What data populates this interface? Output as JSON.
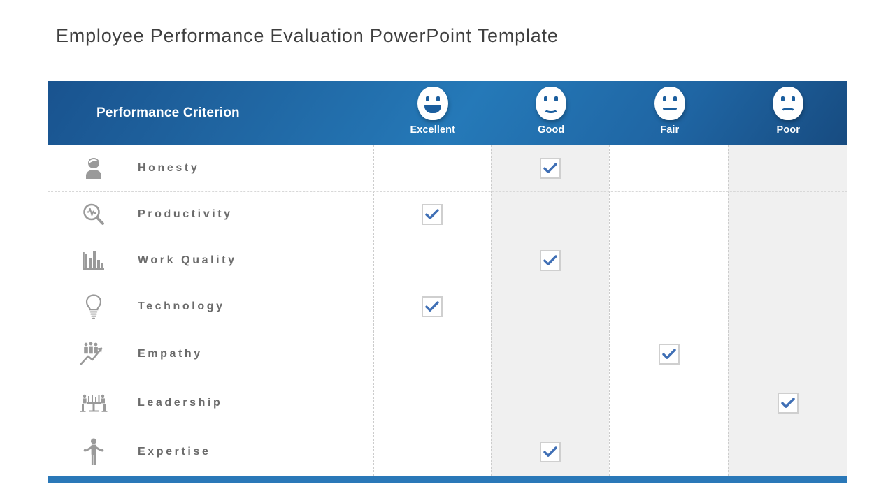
{
  "title": "Employee Performance Evaluation PowerPoint Template",
  "theme": {
    "header_blue_dark": "#174b80",
    "header_blue_light": "#2579b8",
    "bottom_bar_blue": "#2a78b8",
    "check_blue": "#3f6fb5",
    "stripe_gray": "#f0f0f0",
    "icon_gray": "#9a9a9a",
    "label_gray": "#6b6b6b",
    "title_gray": "#3f3f3f"
  },
  "table": {
    "criterion_header": "Performance Criterion",
    "ratings": [
      {
        "label": "Excellent",
        "face": "smiley-open-mouth-icon"
      },
      {
        "label": "Good",
        "face": "smiley-smile-icon"
      },
      {
        "label": "Fair",
        "face": "smiley-neutral-icon"
      },
      {
        "label": "Poor",
        "face": "smiley-frown-icon"
      }
    ],
    "shaded_columns": [
      "Good",
      "Poor"
    ],
    "rows": [
      {
        "label": "Honesty",
        "icon": "person-icon",
        "rating": "Good"
      },
      {
        "label": "Productivity",
        "icon": "magnifier-pulse-icon",
        "rating": "Excellent"
      },
      {
        "label": "Work Quality",
        "icon": "bar-chart-icon",
        "rating": "Good"
      },
      {
        "label": "Technology",
        "icon": "lightbulb-icon",
        "rating": "Excellent"
      },
      {
        "label": "Empathy",
        "icon": "team-growth-icon",
        "rating": "Fair"
      },
      {
        "label": "Leadership",
        "icon": "meeting-table-icon",
        "rating": "Poor"
      },
      {
        "label": "Expertise",
        "icon": "person-arms-out-icon",
        "rating": "Good"
      }
    ]
  },
  "chart_data": {
    "type": "table",
    "title": "Employee Performance Evaluation PowerPoint Template",
    "columns": [
      "Performance Criterion",
      "Excellent",
      "Good",
      "Fair",
      "Poor"
    ],
    "rows": [
      {
        "criterion": "Honesty",
        "Excellent": false,
        "Good": true,
        "Fair": false,
        "Poor": false
      },
      {
        "criterion": "Productivity",
        "Excellent": true,
        "Good": false,
        "Fair": false,
        "Poor": false
      },
      {
        "criterion": "Work Quality",
        "Excellent": false,
        "Good": true,
        "Fair": false,
        "Poor": false
      },
      {
        "criterion": "Technology",
        "Excellent": true,
        "Good": false,
        "Fair": false,
        "Poor": false
      },
      {
        "criterion": "Empathy",
        "Excellent": false,
        "Good": false,
        "Fair": true,
        "Poor": false
      },
      {
        "criterion": "Leadership",
        "Excellent": false,
        "Good": false,
        "Fair": false,
        "Poor": true
      },
      {
        "criterion": "Expertise",
        "Excellent": false,
        "Good": true,
        "Fair": false,
        "Poor": false
      }
    ]
  }
}
